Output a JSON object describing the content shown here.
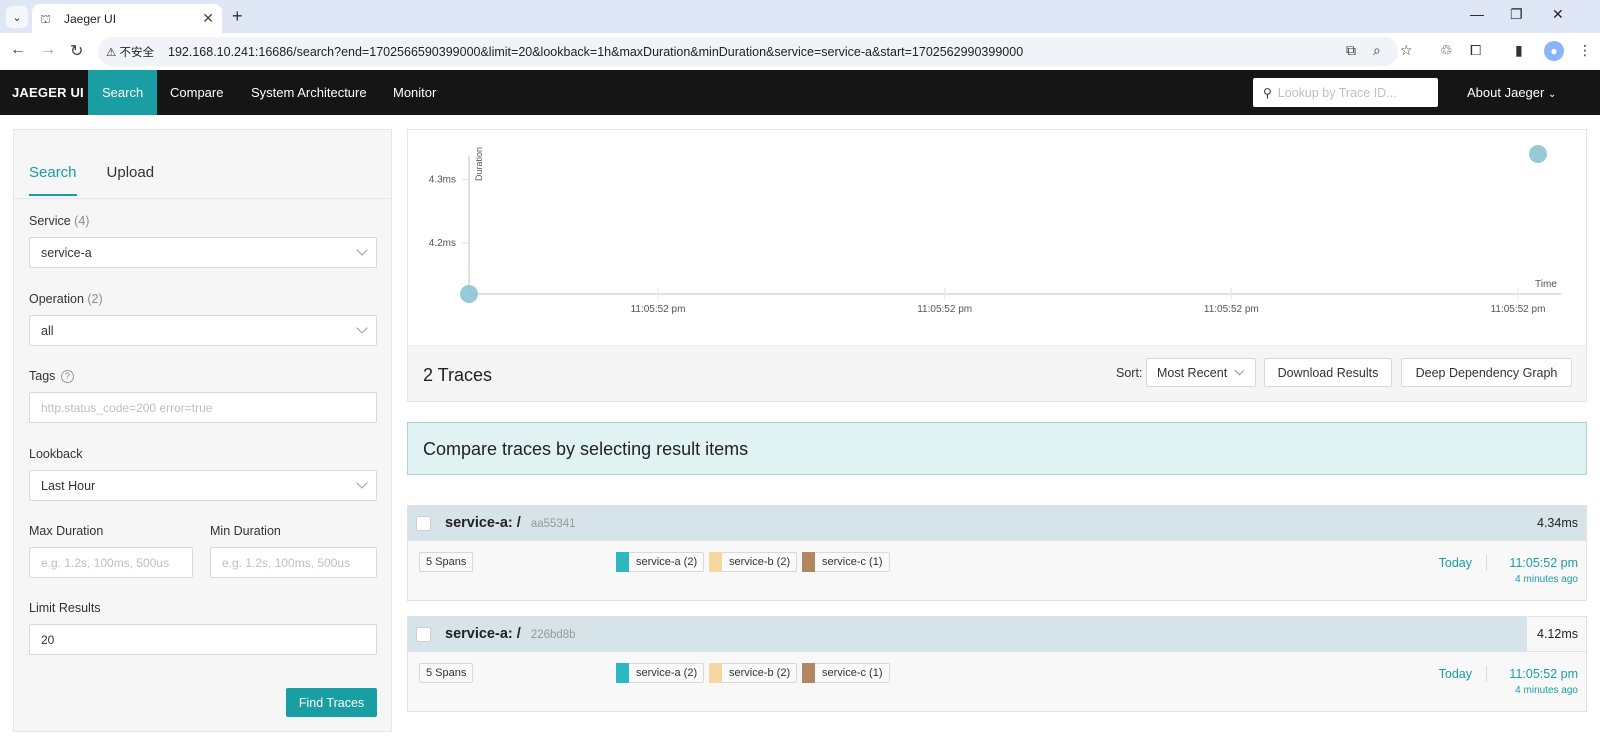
{
  "browser": {
    "tab_title": "Jaeger UI",
    "security_label": "不安全",
    "url": "192.168.10.241:16686/search?end=1702566590399000&limit=20&lookback=1h&maxDuration&minDuration&service=service-a&start=1702562990399000"
  },
  "topnav": {
    "brand": "JAEGER UI",
    "items": [
      "Search",
      "Compare",
      "System Architecture",
      "Monitor"
    ],
    "active": "Search",
    "lookup_placeholder": "Lookup by Trace ID...",
    "about": "About Jaeger"
  },
  "search_panel": {
    "tabs": [
      "Search",
      "Upload"
    ],
    "service_label": "Service",
    "service_count": "(4)",
    "service_value": "service-a",
    "operation_label": "Operation",
    "operation_count": "(2)",
    "operation_value": "all",
    "tags_label": "Tags",
    "tags_placeholder": "http.status_code=200 error=true",
    "lookback_label": "Lookback",
    "lookback_value": "Last Hour",
    "max_duration_label": "Max Duration",
    "max_duration_placeholder": "e.g. 1.2s, 100ms, 500us",
    "min_duration_label": "Min Duration",
    "min_duration_placeholder": "e.g. 1.2s, 100ms, 500us",
    "limit_label": "Limit Results",
    "limit_value": "20",
    "find_button": "Find Traces"
  },
  "chart_data": {
    "type": "scatter",
    "title": "",
    "xlabel": "Time",
    "ylabel": "Duration",
    "y_ticks": [
      "4.2ms",
      "4.3ms"
    ],
    "x_ticks": [
      "11:05:52 pm",
      "11:05:52 pm",
      "11:05:52 pm",
      "11:05:52 pm"
    ],
    "ylim": [
      4.12,
      4.34
    ],
    "series": [
      {
        "x": [
          0.0,
          1.0
        ],
        "y": [
          4.12,
          4.34
        ]
      }
    ],
    "point_color": "#8cc4d1"
  },
  "results": {
    "count_label": "2 Traces",
    "sort_label": "Sort:",
    "sort_value": "Most Recent",
    "download_button": "Download Results",
    "ddg_button": "Deep Dependency Graph",
    "compare_banner": "Compare traces by selecting result items"
  },
  "traces": [
    {
      "service": "service-a:",
      "operation": "/",
      "id": "aa55341",
      "duration": "4.34ms",
      "spans": "5 Spans",
      "services": [
        {
          "name": "service-a (2)",
          "color": "#2db7c1"
        },
        {
          "name": "service-b (2)",
          "color": "#f7d7a0"
        },
        {
          "name": "service-c (1)",
          "color": "#b08760"
        }
      ],
      "date": "Today",
      "time": "11:05:52 pm",
      "ago": "4 minutes ago",
      "bar_fraction": 1.0
    },
    {
      "service": "service-a:",
      "operation": "/",
      "id": "226bd8b",
      "duration": "4.12ms",
      "spans": "5 Spans",
      "services": [
        {
          "name": "service-a (2)",
          "color": "#2db7c1"
        },
        {
          "name": "service-b (2)",
          "color": "#f7d7a0"
        },
        {
          "name": "service-c (1)",
          "color": "#b08760"
        }
      ],
      "date": "Today",
      "time": "11:05:52 pm",
      "ago": "4 minutes ago",
      "bar_fraction": 0.95
    }
  ],
  "colors": {
    "accent": "#199ea3",
    "nav_bg": "#151515"
  }
}
